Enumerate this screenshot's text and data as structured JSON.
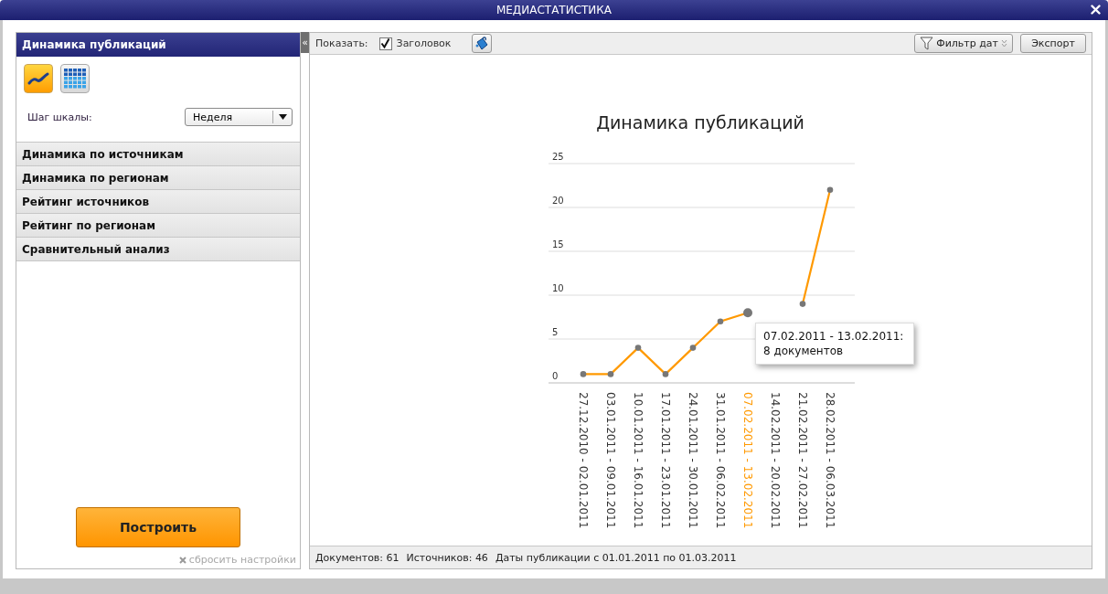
{
  "window": {
    "title": "МЕДИАСТАТИСТИКА"
  },
  "sidebar": {
    "sections": [
      {
        "label": "Динамика публикаций",
        "selected": true
      },
      {
        "label": "Динамика по источникам",
        "selected": false
      },
      {
        "label": "Динамика по регионам",
        "selected": false
      },
      {
        "label": "Рейтинг источников",
        "selected": false
      },
      {
        "label": "Рейтинг по регионам",
        "selected": false
      },
      {
        "label": "Сравнительный анализ",
        "selected": false
      }
    ],
    "view_buttons": [
      {
        "kind": "line",
        "selected": true
      },
      {
        "kind": "table",
        "selected": false
      }
    ],
    "scale_step": {
      "label": "Шаг шкалы:",
      "value": "Неделя"
    },
    "build_button": "Построить",
    "reset_link": "сбросить настройки"
  },
  "collapse_glyph": "«",
  "toolbar": {
    "show_label": "Показать:",
    "title_checkbox": {
      "label": "Заголовок",
      "checked": true
    },
    "date_filter_button": "Фильтр дат",
    "export_button": "Экспорт"
  },
  "chart": {
    "chart_data": {
      "type": "line",
      "title": "Динамика публикаций",
      "categories": [
        "27.12.2010 - 02.01.2011",
        "03.01.2011 - 09.01.2011",
        "10.01.2011 - 16.01.2011",
        "17.01.2011 - 23.01.2011",
        "24.01.2011 - 30.01.2011",
        "31.01.2011 - 06.02.2011",
        "07.02.2011 - 13.02.2011",
        "14.02.2011 - 20.02.2011",
        "21.02.2011 - 27.02.2011",
        "28.02.2011 - 06.03.2011"
      ],
      "series": [
        {
          "color": "#ff9900",
          "marker": true,
          "values": [
            1,
            1,
            4,
            1,
            4,
            7,
            8,
            null,
            9,
            22
          ]
        }
      ],
      "ylim": [
        0,
        25
      ],
      "yticks": [
        0,
        5,
        10,
        15,
        20,
        25
      ],
      "grid": true
    },
    "category_states": [
      {
        "selected": false
      },
      {
        "selected": false
      },
      {
        "selected": false
      },
      {
        "selected": false
      },
      {
        "selected": false
      },
      {
        "selected": false
      },
      {
        "selected": true
      },
      {
        "selected": false
      },
      {
        "selected": false
      },
      {
        "selected": false
      }
    ],
    "tooltip": {
      "text": "07.02.2011 - 13.02.2011: 8 документов"
    }
  },
  "status_bar": [
    "Документов: 61",
    "Источников: 46",
    "Даты публикации с 01.01.2011 по 01.03.2011"
  ]
}
